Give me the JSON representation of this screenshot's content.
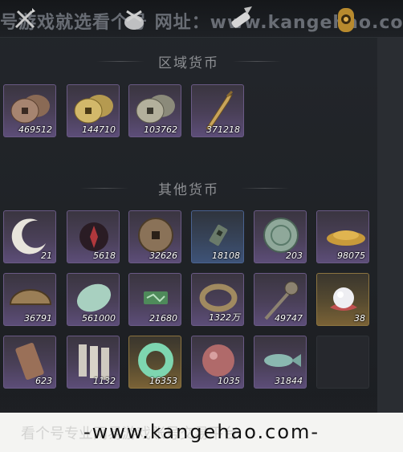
{
  "watermark_top": "号游戏就选看个号   网址：www.kangehao.com",
  "watermark_footer_ghost": "看个号专业网易游戏账号交易平台",
  "footer_url": "-www.kangehao.com-",
  "sections": [
    {
      "title": "区域货币",
      "items": [
        {
          "icon": "copper-coins-icon",
          "count": "469512",
          "rarity": "purple"
        },
        {
          "icon": "gold-coins-icon",
          "count": "144710",
          "rarity": "purple"
        },
        {
          "icon": "silver-coins-icon",
          "count": "103762",
          "rarity": "purple"
        },
        {
          "icon": "golden-feather-blade-icon",
          "count": "371218",
          "rarity": "purple"
        }
      ]
    },
    {
      "title": "其他货币",
      "items": [
        {
          "icon": "crescent-moon-icon",
          "count": "21",
          "rarity": "purple"
        },
        {
          "icon": "red-crystal-icon",
          "count": "5618",
          "rarity": "purple"
        },
        {
          "icon": "bronze-coin-icon",
          "count": "32626",
          "rarity": "purple"
        },
        {
          "icon": "jade-tablet-icon",
          "count": "18108",
          "rarity": "blue"
        },
        {
          "icon": "jade-disc-icon",
          "count": "203",
          "rarity": "purple"
        },
        {
          "icon": "gold-sand-icon",
          "count": "98075",
          "rarity": "purple"
        },
        {
          "icon": "half-coin-icon",
          "count": "36791",
          "rarity": "purple"
        },
        {
          "icon": "jade-stone-icon",
          "count": "561000",
          "rarity": "purple"
        },
        {
          "icon": "green-scroll-icon",
          "count": "21680",
          "rarity": "purple"
        },
        {
          "icon": "coin-string-icon",
          "count": "1322万",
          "rarity": "purple"
        },
        {
          "icon": "sword-coin-icon",
          "count": "49747",
          "rarity": "purple"
        },
        {
          "icon": "pearl-icon",
          "count": "38",
          "rarity": "gold"
        },
        {
          "icon": "bronze-token-icon",
          "count": "623",
          "rarity": "purple"
        },
        {
          "icon": "paper-notes-icon",
          "count": "1132",
          "rarity": "purple"
        },
        {
          "icon": "jade-ring-icon",
          "count": "16353",
          "rarity": "gold"
        },
        {
          "icon": "red-bead-icon",
          "count": "1035",
          "rarity": "purple"
        },
        {
          "icon": "jade-fish-icon",
          "count": "31844",
          "rarity": "purple"
        },
        {
          "icon": "empty-slot",
          "count": "",
          "rarity": "empty"
        }
      ]
    }
  ]
}
